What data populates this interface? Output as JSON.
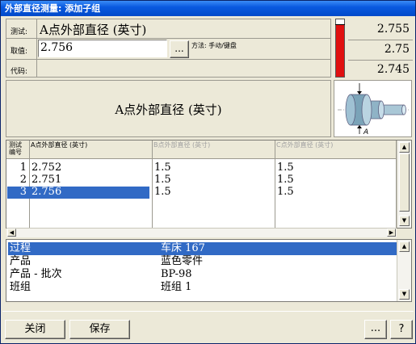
{
  "window": {
    "title": "外部直径测量: 添加子组"
  },
  "header": {
    "test_label": "测试:",
    "test_value": "A点外部直径 (英寸)",
    "input_label": "取值:",
    "input_value": "2.756",
    "browse_button": "...",
    "method_label": "方法: 手动/键盘",
    "code_label": "代码:"
  },
  "limits": {
    "upper": "2.755",
    "target": "2.75",
    "lower": "2.745",
    "bar_fill_fraction": 0.92,
    "bar_color": "#e01010"
  },
  "characteristic_title": "A点外部直径 (英寸)",
  "diagram": {
    "point_label": "A"
  },
  "grid": {
    "index_header": "测试\n编号",
    "columns": [
      {
        "header": "A点外部直径 (英寸)",
        "values": [
          "2.752",
          "2.751",
          "2.756"
        ]
      },
      {
        "header": "B点外部直径 (英寸)",
        "values": [
          "1.5",
          "1.5",
          "1.5"
        ]
      },
      {
        "header": "C点外部直径 (英寸)",
        "values": [
          "1.5",
          "1.5",
          "1.5"
        ]
      }
    ],
    "row_numbers": [
      "1",
      "2",
      "3"
    ],
    "selected_row": 2,
    "selection_color": "#316ac5"
  },
  "info": [
    {
      "key": "过程",
      "value": "车床 167"
    },
    {
      "key": "产品",
      "value": "蓝色零件"
    },
    {
      "key": "产品 - 批次",
      "value": "BP-98"
    },
    {
      "key": "班组",
      "value": "班组 1"
    }
  ],
  "footer": {
    "close": "关闭",
    "save": "保存",
    "more": "...",
    "help": "?"
  }
}
